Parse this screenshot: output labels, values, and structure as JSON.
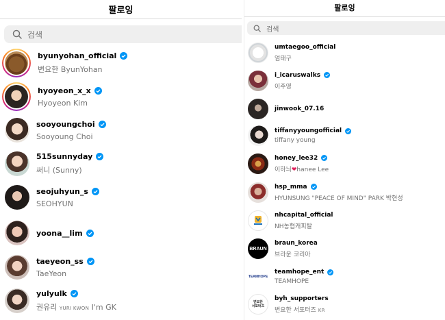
{
  "left": {
    "title": "팔로잉",
    "search_placeholder": "검색",
    "users": [
      {
        "username": "byunyohan_official",
        "name": "변요한 ByunYohan",
        "verified": true,
        "story": true,
        "avatar": "dog-photo"
      },
      {
        "username": "hyoyeon_x_x",
        "name": "Hyoyeon Kim",
        "verified": true,
        "story": true,
        "avatar": "person-photo"
      },
      {
        "username": "sooyoungchoi",
        "name": "Sooyoung Choi",
        "verified": true,
        "story": false,
        "avatar": "person-photo"
      },
      {
        "username": "515sunnyday",
        "name": "써니 (Sunny)",
        "verified": true,
        "story": false,
        "avatar": "person-photo"
      },
      {
        "username": "seojuhyun_s",
        "name": "SEOHYUN",
        "verified": true,
        "story": false,
        "avatar": "person-photo"
      },
      {
        "username": "yoona__lim",
        "name": "",
        "verified": true,
        "story": false,
        "avatar": "person-photo"
      },
      {
        "username": "taeyeon_ss",
        "name": "TaeYeon",
        "verified": true,
        "story": false,
        "avatar": "person-photo"
      },
      {
        "username": "yulyulk",
        "name_main": "권유리",
        "name_small": "YURI KWON",
        "name_tail": "I'm GK",
        "verified": true,
        "story": false,
        "avatar": "person-photo"
      }
    ]
  },
  "right": {
    "title": "팔로잉",
    "search_placeholder": "검색",
    "users": [
      {
        "username": "umtaegoo_official",
        "name": "엄태구",
        "verified": false,
        "avatar": "white-dog"
      },
      {
        "username": "i_icaruswalks",
        "name": "이주영",
        "verified": true,
        "avatar": "person-photo"
      },
      {
        "username": "jinwook_07.16",
        "name": "",
        "verified": false,
        "avatar": "person-photo"
      },
      {
        "username": "tiffanyyoungofficial",
        "name": "tiffany young",
        "verified": true,
        "avatar": "person-photo"
      },
      {
        "username": "honey_lee32",
        "name_before": "이하늬",
        "heart": "❤",
        "name_after": "hanee Lee",
        "verified": true,
        "avatar": "person-photo"
      },
      {
        "username": "hsp_mma",
        "name": "HYUNSUNG \"PEACE OF MIND\" PARK 박현성",
        "verified": true,
        "avatar": "person-photo"
      },
      {
        "username": "nhcapital_official",
        "name": "NH농협캐피탈",
        "verified": false,
        "avatar": "nh-logo"
      },
      {
        "username": "braun_korea",
        "name": "브라운 코리아",
        "verified": false,
        "avatar": "braun-logo",
        "logo_text": "BRAUN"
      },
      {
        "username": "teamhope_ent",
        "name": "TEAMHOPE",
        "verified": true,
        "avatar": "teamhope-logo",
        "logo_text": "TEAMHOPE"
      },
      {
        "username": "byh_supporters",
        "name": "변요한 서포터즈",
        "name_suffix": "KR",
        "verified": false,
        "avatar": "supporters-logo",
        "logo_text": "변요한 서포터즈"
      }
    ]
  },
  "colors": {
    "verified": "#0095f6",
    "secondary_text": "#737373",
    "search_bg": "#efefef",
    "divider": "#dbdbdb"
  }
}
